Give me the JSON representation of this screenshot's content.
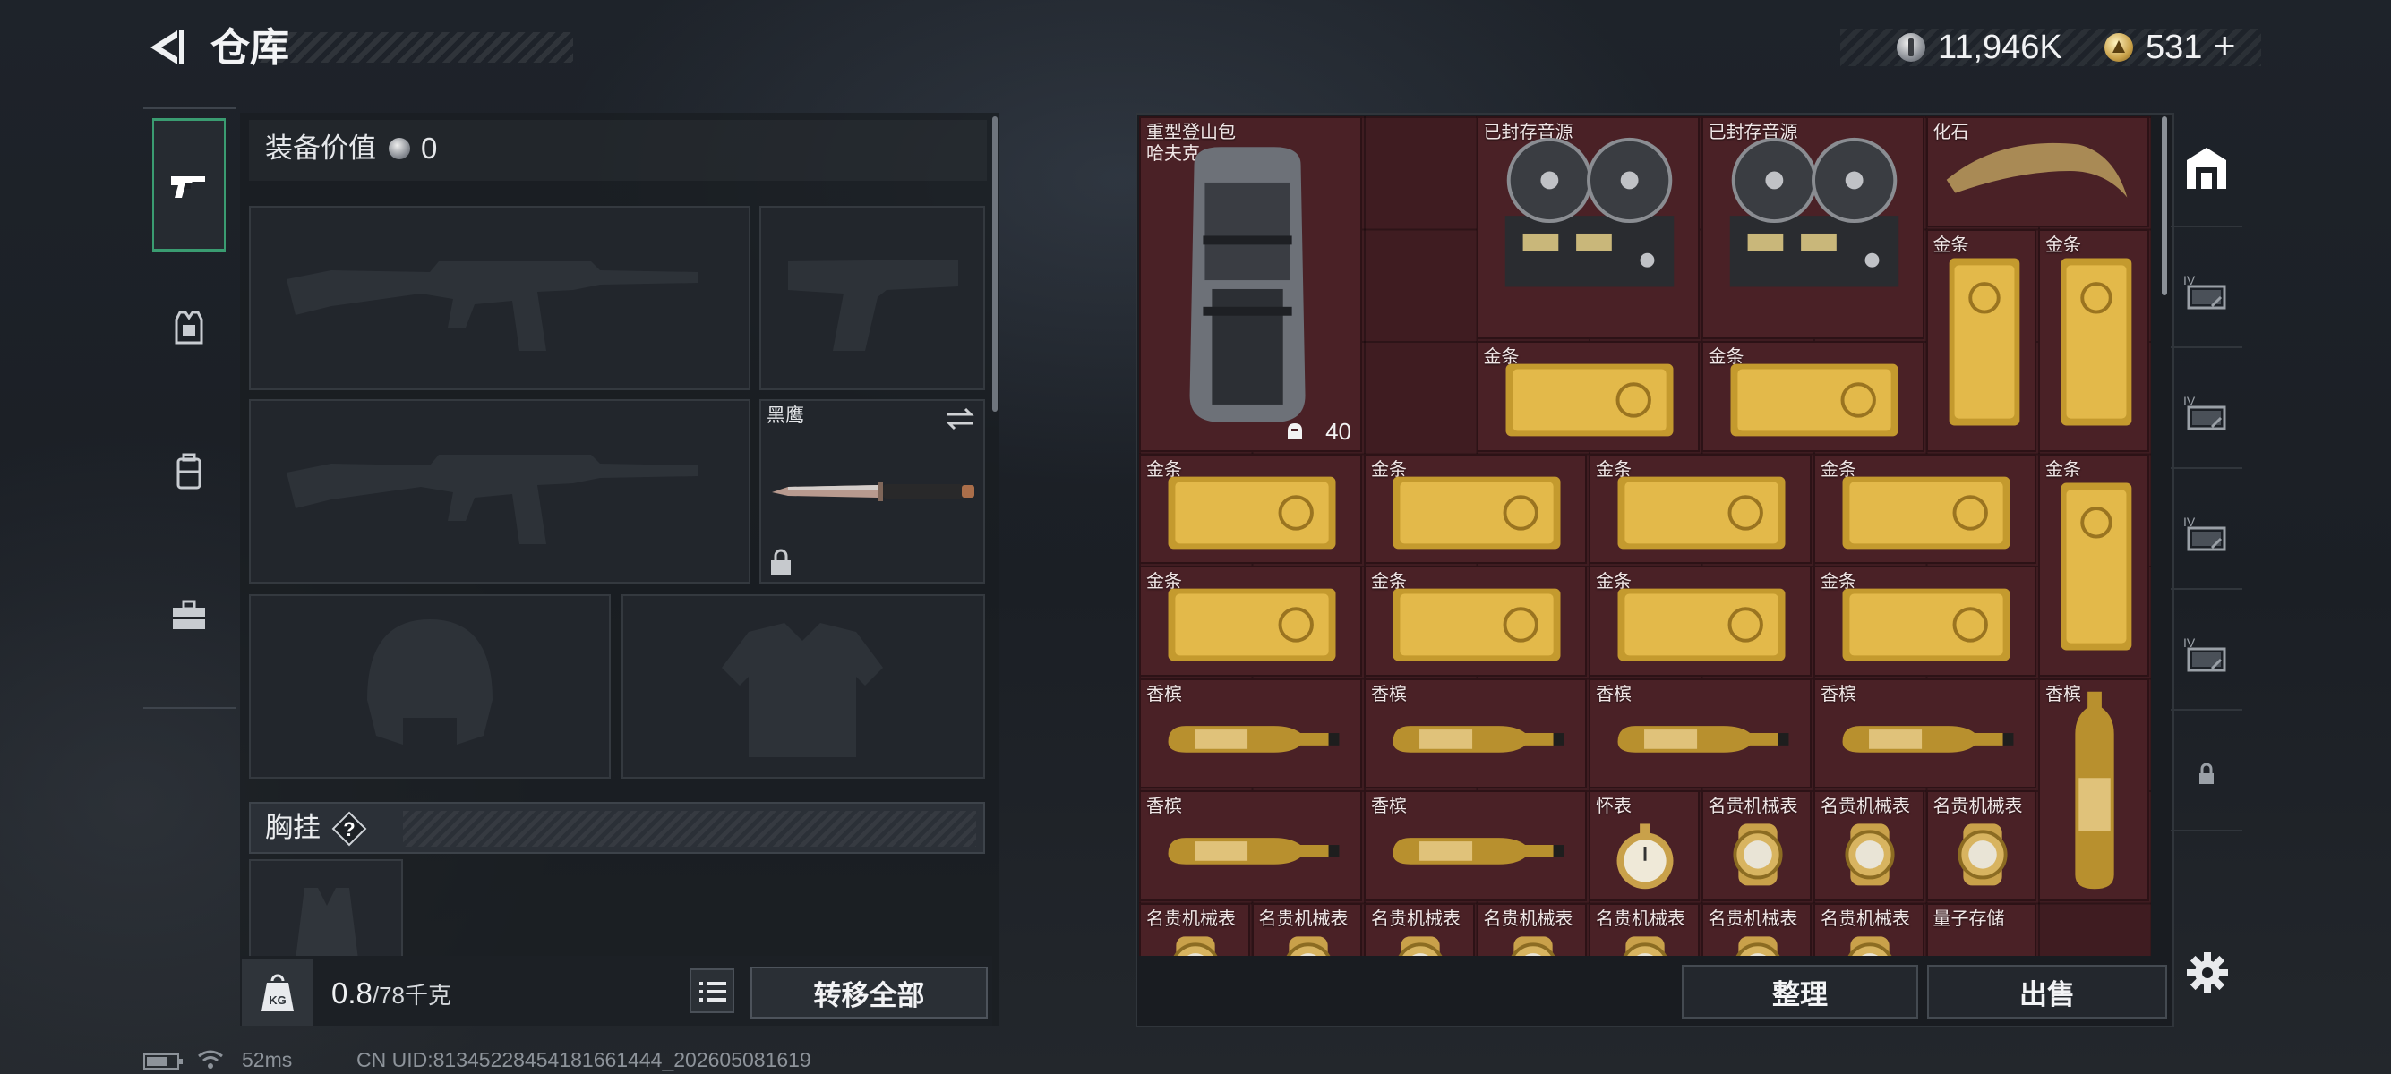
{
  "header": {
    "title": "仓库",
    "silver_amount": "11,946K",
    "gold_amount": "531",
    "add_symbol": "+",
    "silver_icon": "silver-coin-icon",
    "gold_icon": "gold-coin-icon"
  },
  "left_rail": {
    "tabs": [
      {
        "icon": "pistol-icon",
        "active": true
      },
      {
        "icon": "armor-vest-icon",
        "active": false
      },
      {
        "icon": "backpack-icon",
        "active": false
      },
      {
        "icon": "toolbox-icon",
        "active": false
      }
    ]
  },
  "equipment": {
    "value_label": "装备价值",
    "value_number": "0",
    "melee_name": "黑鹰",
    "chest_rig_label": "胸挂",
    "chest_rig_help": "?",
    "weight_current": "0.8",
    "weight_max": "/78千克",
    "transfer_all": "转移全部"
  },
  "storage": {
    "items": [
      {
        "name": "重型登山包",
        "name2": "哈夫克",
        "capacity": "40"
      },
      {
        "name": "已封存音源"
      },
      {
        "name": "已封存音源"
      },
      {
        "name": "化石"
      },
      {
        "name": "金条"
      },
      {
        "name": "金条"
      },
      {
        "name": "金条"
      },
      {
        "name": "金条"
      },
      {
        "name": "金条"
      },
      {
        "name": "金条"
      },
      {
        "name": "金条"
      },
      {
        "name": "金条"
      },
      {
        "name": "金条"
      },
      {
        "name": "金条"
      },
      {
        "name": "金条"
      },
      {
        "name": "金条"
      },
      {
        "name": "金条"
      },
      {
        "name": "香槟"
      },
      {
        "name": "香槟"
      },
      {
        "name": "香槟"
      },
      {
        "name": "香槟"
      },
      {
        "name": "香槟"
      },
      {
        "name": "香槟"
      },
      {
        "name": "香槟"
      },
      {
        "name": "怀表"
      },
      {
        "name": "名贵机械表"
      },
      {
        "name": "名贵机械表"
      },
      {
        "name": "名贵机械表"
      },
      {
        "name": "名贵机械表"
      },
      {
        "name": "名贵机械表"
      },
      {
        "name": "名贵机械表"
      },
      {
        "name": "名贵机械表"
      },
      {
        "name": "名贵机械表"
      },
      {
        "name": "名贵机械表"
      },
      {
        "name": "名贵机械表"
      },
      {
        "name": "量子存储"
      }
    ],
    "sort_button": "整理",
    "sell_button": "出售"
  },
  "storage_tabs": [
    {
      "icon": "vault-icon",
      "tier": ""
    },
    {
      "icon": "storage-box-icon",
      "tier": "IV"
    },
    {
      "icon": "storage-box-icon",
      "tier": "IV"
    },
    {
      "icon": "storage-box-icon",
      "tier": "IV"
    },
    {
      "icon": "storage-box-icon",
      "tier": "IV"
    },
    {
      "icon": "lock-icon",
      "tier": ""
    }
  ],
  "status": {
    "ping": "52ms",
    "uid": "CN UID:8134522845418166​1444_202605081619"
  }
}
